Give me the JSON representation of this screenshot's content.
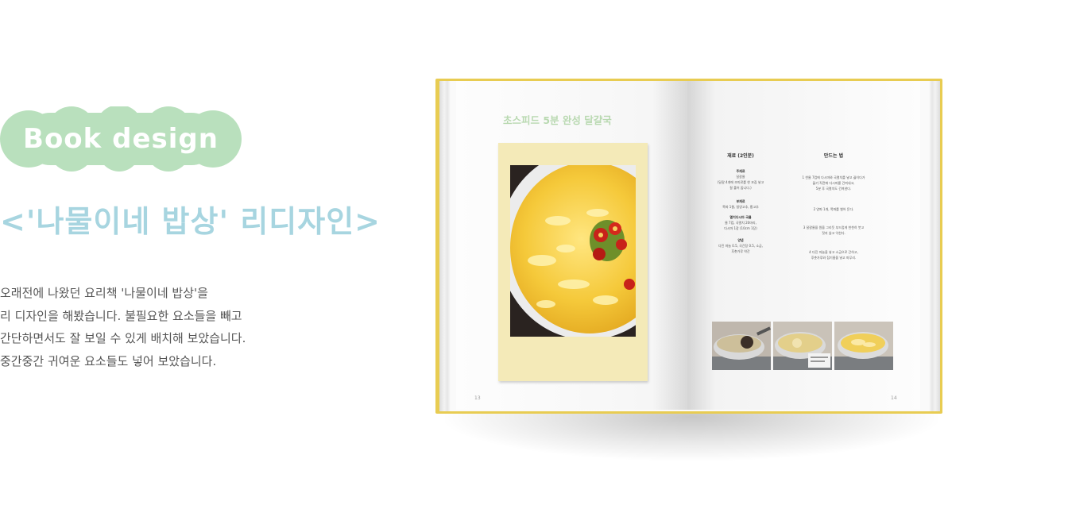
{
  "tag": {
    "label": "Book design",
    "color": "#b9e0bd"
  },
  "title": "<'나물이네 밥상' 리디자인>",
  "title_color": "#a7d5e0",
  "description": [
    "오래전에 나왔던 요리책 '나물이네 밥상'을",
    "리 디자인을 해봤습니다. 불필요한 요소들을 빼고",
    "간단하면서도 잘 보일 수 있게 배치해 보았습니다.",
    "중간중간 귀여운 요소들도 넣어 보았습니다."
  ],
  "book": {
    "cover_color": "#e8cc52",
    "left_page": {
      "recipe_title": "초스피드 5분 완성 달걀국",
      "page_number": "13"
    },
    "right_page": {
      "ingredients_heading": "재료 (2인분)",
      "method_heading": "만드는 법",
      "ingredient_groups": [
        {
          "title": "주재료",
          "lines": [
            "달걀물",
            "(달걀 4개에 조미료를 한 꼬집 넣고",
            "잘 풀어 둡니다.)"
          ]
        },
        {
          "title": "부재료",
          "lines": [
            "쪽파 1줄, 청양고추, 홍고추"
          ]
        },
        {
          "title": "멸치다시마 국물",
          "lines": [
            "물 7컵, 국멸치 20마리,",
            "다시마 1장 (10cm 1장)"
          ]
        },
        {
          "title": "양념",
          "lines": [
            "다진 마늘 0.5, 국간장 0.5, 소금,",
            "후춧가루 약간"
          ]
        }
      ],
      "steps": [
        {
          "num": "1",
          "lines": [
            "찬물 7컵에 다시마와 국멸치를 넣고 끓이다가",
            "끓기 직전에 다시마를 건져내고,",
            "5분 후 국멸치도 건져낸다."
          ]
        },
        {
          "num": "2",
          "lines": [
            "양파 1개, 쪽파를 썰어 둔다."
          ]
        },
        {
          "num": "3",
          "lines": [
            "달걀물을 원을 그리듯 부드럽게 천천히 붓고",
            "젓지 않고 익힌다."
          ]
        },
        {
          "num": "4",
          "lines": [
            "다진 마늘을 넣고 소금으로 간하고,",
            "후춧가루와 참기름을 넣고 마무리."
          ]
        }
      ],
      "page_number": "14"
    }
  }
}
